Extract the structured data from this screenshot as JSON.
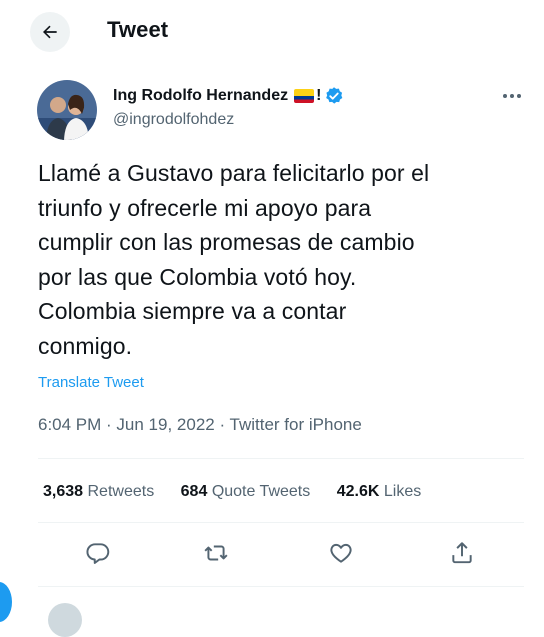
{
  "header": {
    "back_icon": "arrow-left-icon",
    "title": "Tweet"
  },
  "author": {
    "name": "Ing Rodolfo Hernandez",
    "name_suffix": "!",
    "flag_icon": "colombia-flag-icon",
    "verified_icon": "verified-badge-icon",
    "handle": "@ingrodolfohdez",
    "more_icon": "more-horizontal-icon"
  },
  "tweet": {
    "lines": [
      "Llamé a Gustavo para felicitarlo por el",
      "triunfo y ofrecerle mi apoyo para",
      "cumplir con las promesas de cambio",
      "por las que Colombia votó hoy.",
      "Colombia siempre va a contar",
      "conmigo."
    ],
    "translate_label": "Translate Tweet",
    "timestamp": "6:04 PM · Jun 19, 2022 · Twitter for iPhone"
  },
  "stats": {
    "retweets_count": "3,638",
    "retweets_label": "Retweets",
    "quotes_count": "684",
    "quotes_label": "Quote Tweets",
    "likes_count": "42.6K",
    "likes_label": "Likes"
  },
  "actions": {
    "reply_icon": "reply-icon",
    "retweet_icon": "retweet-icon",
    "like_icon": "heart-icon",
    "share_icon": "share-icon"
  },
  "colors": {
    "accent": "#1d9bf0",
    "text_primary": "#0f1419",
    "text_secondary": "#536471",
    "divider": "#eff3f4"
  }
}
